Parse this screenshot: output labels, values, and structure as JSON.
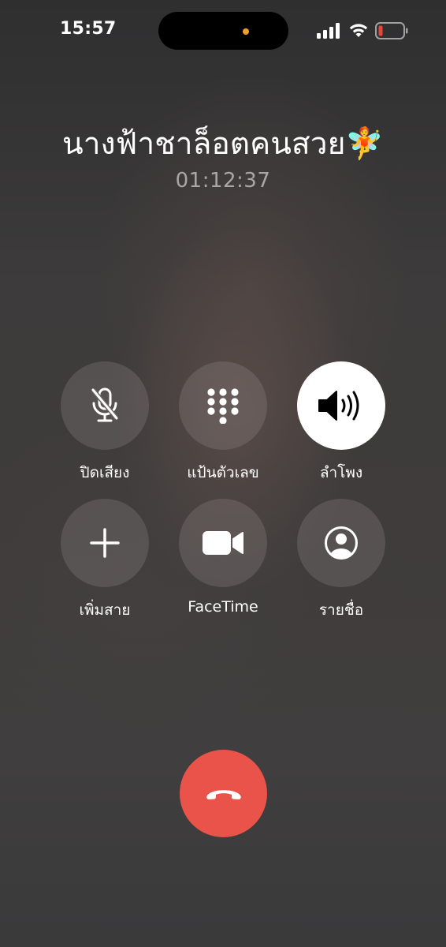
{
  "status_bar": {
    "time": "15:57"
  },
  "call": {
    "caller_name": "นางฟ้าชาล็อตคนสวย🧚",
    "duration": "01:12:37"
  },
  "controls": [
    {
      "label": "ปิดเสียง",
      "icon": "mic-muted-icon",
      "active": false
    },
    {
      "label": "แป้นตัวเลข",
      "icon": "keypad-icon",
      "active": false
    },
    {
      "label": "ลำโพง",
      "icon": "speaker-icon",
      "active": true
    },
    {
      "label": "เพิ่มสาย",
      "icon": "plus-icon",
      "active": false
    },
    {
      "label": "FaceTime",
      "icon": "video-camera-icon",
      "active": false
    },
    {
      "label": "รายชื่อ",
      "icon": "contact-icon",
      "active": false
    }
  ],
  "colors": {
    "end_call": "#e9534a",
    "active_button": "#ffffff",
    "island_dot": "#f0a030",
    "battery_low": "#e9463b"
  }
}
